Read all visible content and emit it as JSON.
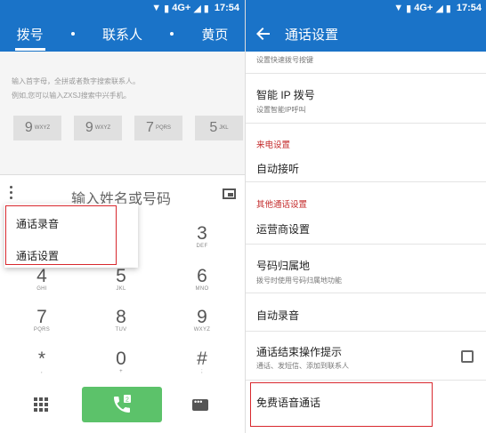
{
  "status_bar": {
    "network": "4G+",
    "time": "17:54"
  },
  "dialer": {
    "tabs": [
      {
        "label": "拨号",
        "active": true
      },
      {
        "label": "联系人",
        "active": false
      },
      {
        "label": "黄页",
        "active": false
      }
    ],
    "hint_line1": "输入首字母，全拼或者数字搜索联系人。",
    "hint_line2": "例如,您可以输入ZXSJ搜索中兴手机。",
    "speed_dial": [
      {
        "digit": "9",
        "letters": "WXYZ"
      },
      {
        "digit": "9",
        "letters": "WXYZ"
      },
      {
        "digit": "7",
        "letters": "PQRS"
      },
      {
        "digit": "5",
        "letters": "JKL"
      }
    ],
    "input_placeholder": "输入姓名或号码",
    "menu": {
      "items": [
        "通话录音",
        "通话设置"
      ]
    },
    "keys": [
      {
        "num": "3",
        "sub": "DEF"
      },
      {
        "num": "4",
        "sub": "GHI"
      },
      {
        "num": "5",
        "sub": "JKL"
      },
      {
        "num": "6",
        "sub": "MNO"
      },
      {
        "num": "7",
        "sub": "PQRS"
      },
      {
        "num": "8",
        "sub": "TUV"
      },
      {
        "num": "9",
        "sub": "WXYZ"
      },
      {
        "num": "*",
        "sub": ","
      },
      {
        "num": "0",
        "sub": "+"
      },
      {
        "num": "#",
        "sub": ";"
      }
    ]
  },
  "settings": {
    "title": "通话设置",
    "top_partial": "设置快速拨号按键",
    "items": {
      "smart_ip_title": "智能 IP 拨号",
      "smart_ip_sub": "设置智能IP呼叫",
      "incoming_header": "来电设置",
      "auto_answer": "自动接听",
      "other_header": "其他通话设置",
      "carrier": "运营商设置",
      "location_title": "号码归属地",
      "location_sub": "拨号时使用号码归属地功能",
      "auto_record": "自动录音",
      "end_prompt_title": "通话结束操作提示",
      "end_prompt_sub": "通话、发短信、添加到联系人",
      "free_voice": "免费语音通话"
    },
    "end_prompt_checked": false
  },
  "colors": {
    "primary": "#1a73c8",
    "call_green": "#5cc26a",
    "highlight_red": "#d8282e",
    "section_red": "#c42b2b"
  }
}
